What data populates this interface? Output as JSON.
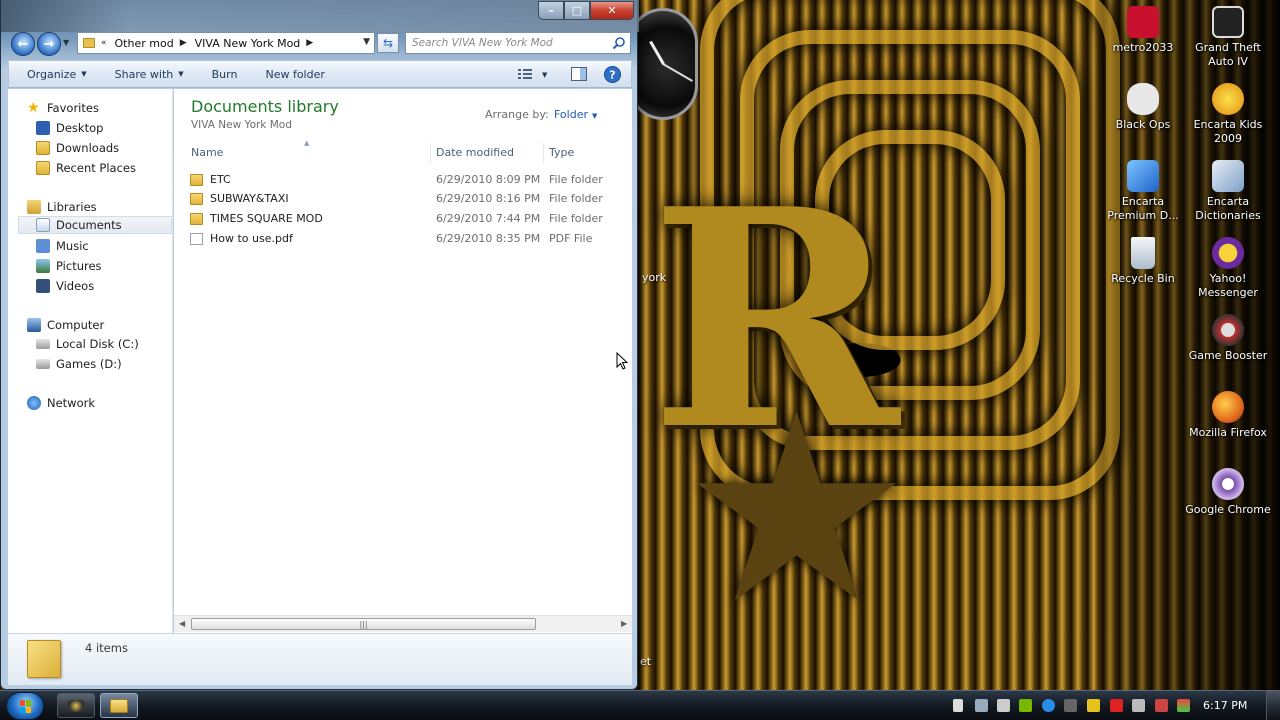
{
  "window": {
    "breadcrumb": [
      "Other mod",
      "VIVA New York Mod"
    ],
    "search_placeholder": "Search VIVA New York Mod"
  },
  "toolbar": {
    "organize": "Organize",
    "share_with": "Share with",
    "burn": "Burn",
    "new_folder": "New folder"
  },
  "nav_pane": {
    "favorites": {
      "label": "Favorites",
      "items": [
        "Desktop",
        "Downloads",
        "Recent Places"
      ]
    },
    "libraries": {
      "label": "Libraries",
      "items": [
        "Documents",
        "Music",
        "Pictures",
        "Videos"
      ]
    },
    "computer": {
      "label": "Computer",
      "items": [
        "Local Disk (C:)",
        "Games (D:)"
      ]
    },
    "network": {
      "label": "Network"
    }
  },
  "library": {
    "title": "Documents library",
    "subtitle": "VIVA New York Mod",
    "arrange_label": "Arrange by:",
    "arrange_value": "Folder"
  },
  "columns": {
    "name": "Name",
    "date": "Date modified",
    "type": "Type"
  },
  "files": [
    {
      "name": "ETC",
      "date": "6/29/2010 8:09 PM",
      "type": "File folder",
      "kind": "folder"
    },
    {
      "name": "SUBWAY&TAXI",
      "date": "6/29/2010 8:16 PM",
      "type": "File folder",
      "kind": "folder"
    },
    {
      "name": "TIMES SQUARE MOD",
      "date": "6/29/2010 7:44 PM",
      "type": "File folder",
      "kind": "folder"
    },
    {
      "name": "How to use.pdf",
      "date": "6/29/2010 8:35 PM",
      "type": "PDF File",
      "kind": "pdf"
    }
  ],
  "details": {
    "item_count": "4 items"
  },
  "desktop_icons": [
    {
      "label": "metro2033",
      "icon": "metro2033-icon",
      "color": "#c8102e"
    },
    {
      "label": "Grand Theft Auto IV",
      "icon": "gta4-icon",
      "color": "#dddddd"
    },
    {
      "label": "Black Ops",
      "icon": "black-ops-icon",
      "color": "#e8e8e8"
    },
    {
      "label": "Encarta Kids 2009",
      "icon": "encarta-kids-icon",
      "color": "#f2b51c"
    },
    {
      "label": "Encarta Premium D...",
      "icon": "encarta-premium-icon",
      "color": "#3a8be0"
    },
    {
      "label": "Encarta Dictionaries",
      "icon": "encarta-dictionaries-icon",
      "color": "#8fb2d8"
    },
    {
      "label": "Recycle Bin",
      "icon": "recycle-bin-icon",
      "color": "#cfd8e0"
    },
    {
      "label": "Yahoo! Messenger",
      "icon": "yahoo-messenger-icon",
      "color": "#6b2a9e"
    },
    {
      "label": "Game Booster",
      "icon": "game-booster-icon",
      "color": "#c23030"
    },
    {
      "label": "Mozilla Firefox",
      "icon": "firefox-icon",
      "color": "#e36b1f"
    },
    {
      "label": "Google Chrome",
      "icon": "chrome-icon",
      "color": "#b48ad8"
    }
  ],
  "desktop_partial_labels": {
    "york": "york",
    "et": "et"
  },
  "taskbar": {
    "time": "6:17 PM"
  }
}
